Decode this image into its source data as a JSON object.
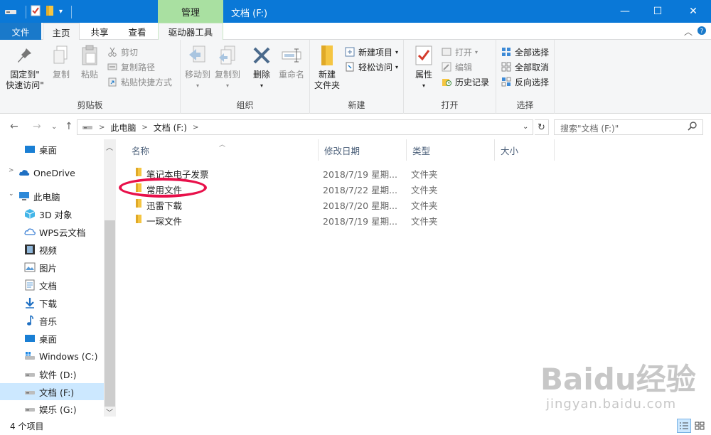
{
  "titlebar": {
    "contextual_tab": "管理",
    "window_title": "文档 (F:)",
    "minimize": "—",
    "maximize": "☐",
    "close": "✕"
  },
  "tabs": {
    "file": "文件",
    "home": "主页",
    "share": "共享",
    "view": "查看",
    "drive_tools": "驱动器工具"
  },
  "ribbon": {
    "clipboard": {
      "label": "剪贴板",
      "pin": [
        "固定到\"",
        "快速访问\""
      ],
      "copy": "复制",
      "paste": "粘贴",
      "cut": "剪切",
      "copy_path": "复制路径",
      "paste_shortcut": "粘贴快捷方式"
    },
    "organize": {
      "label": "组织",
      "move_to": "移动到",
      "copy_to": "复制到",
      "delete": "删除",
      "rename": "重命名"
    },
    "new": {
      "label": "新建",
      "new_folder": [
        "新建",
        "文件夹"
      ],
      "new_item": "新建项目",
      "easy_access": "轻松访问"
    },
    "open": {
      "label": "打开",
      "properties": "属性",
      "open": "打开",
      "edit": "编辑",
      "history": "历史记录"
    },
    "select": {
      "label": "选择",
      "select_all": "全部选择",
      "select_none": "全部取消",
      "invert": "反向选择"
    }
  },
  "address": {
    "crumbs": [
      "此电脑",
      "文档 (F:)"
    ],
    "search_placeholder": "搜索\"文档 (F:)\""
  },
  "nav": {
    "items": [
      "桌面",
      "OneDrive",
      "此电脑",
      "3D 对象",
      "WPS云文档",
      "视频",
      "图片",
      "文档",
      "下载",
      "音乐",
      "桌面",
      "Windows (C:)",
      "软件 (D:)",
      "文档 (F:)",
      "娱乐 (G:)"
    ]
  },
  "columns": {
    "name": "名称",
    "modified": "修改日期",
    "type": "类型",
    "size": "大小"
  },
  "files": [
    {
      "name": "笔记本电子发票",
      "date": "2018/7/19 星期...",
      "type": "文件夹"
    },
    {
      "name": "常用文件",
      "date": "2018/7/22 星期...",
      "type": "文件夹"
    },
    {
      "name": "迅雷下载",
      "date": "2018/7/20 星期...",
      "type": "文件夹"
    },
    {
      "name": "一琛文件",
      "date": "2018/7/19 星期...",
      "type": "文件夹"
    }
  ],
  "status": {
    "count": "4 个项目"
  },
  "watermark": {
    "brand": "Baidu经验",
    "url": "jingyan.baidu.com"
  },
  "colors": {
    "titlebar": "#0a78d7",
    "contextual_tab": "#a9e0a1",
    "folder": "#f5c542",
    "selection": "#cce8ff",
    "annotation_circle": "#e8104a"
  }
}
